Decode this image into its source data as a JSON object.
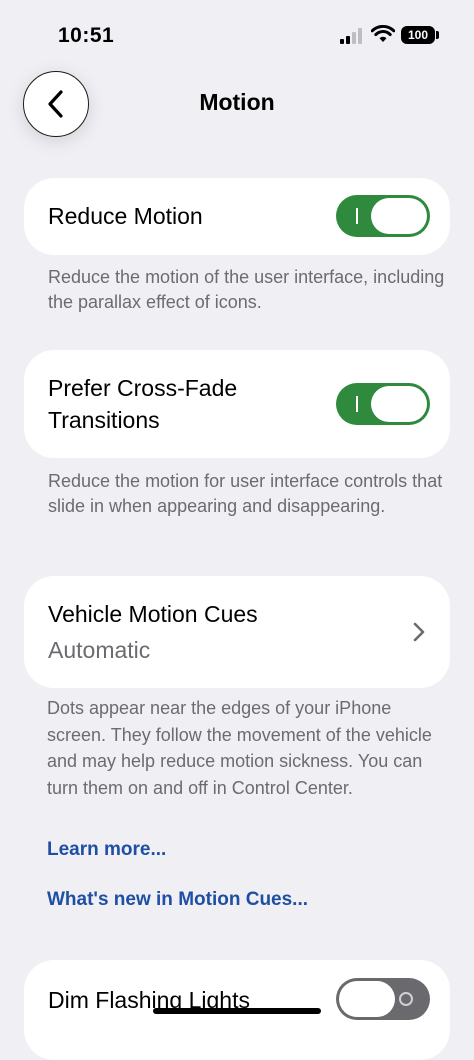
{
  "status": {
    "time": "10:51",
    "battery": "100"
  },
  "nav": {
    "title": "Motion"
  },
  "reduce_motion": {
    "label": "Reduce Motion",
    "enabled": true,
    "footnote": "Reduce the motion of the user interface, including the parallax effect of icons."
  },
  "cross_fade": {
    "label_line1": "Prefer Cross-Fade",
    "label_line2": "Transitions",
    "enabled": true,
    "footnote": "Reduce the motion for user interface controls that slide in when appearing and disappearing."
  },
  "vehicle_cues": {
    "label": "Vehicle Motion Cues",
    "value": "Automatic",
    "footnote": "Dots appear near the edges of your iPhone screen. They follow the movement of the vehicle and may help reduce motion sickness. You can turn them on and off in Control Center.",
    "learn_more": "Learn more...",
    "whats_new": "What's new in Motion Cues..."
  },
  "dim_flashing": {
    "label": "Dim Flashing Lights",
    "enabled": false
  },
  "colors": {
    "toggle_on": "#2f8a3e",
    "toggle_off": "#6a6a6e",
    "link": "#1f4fa3"
  }
}
